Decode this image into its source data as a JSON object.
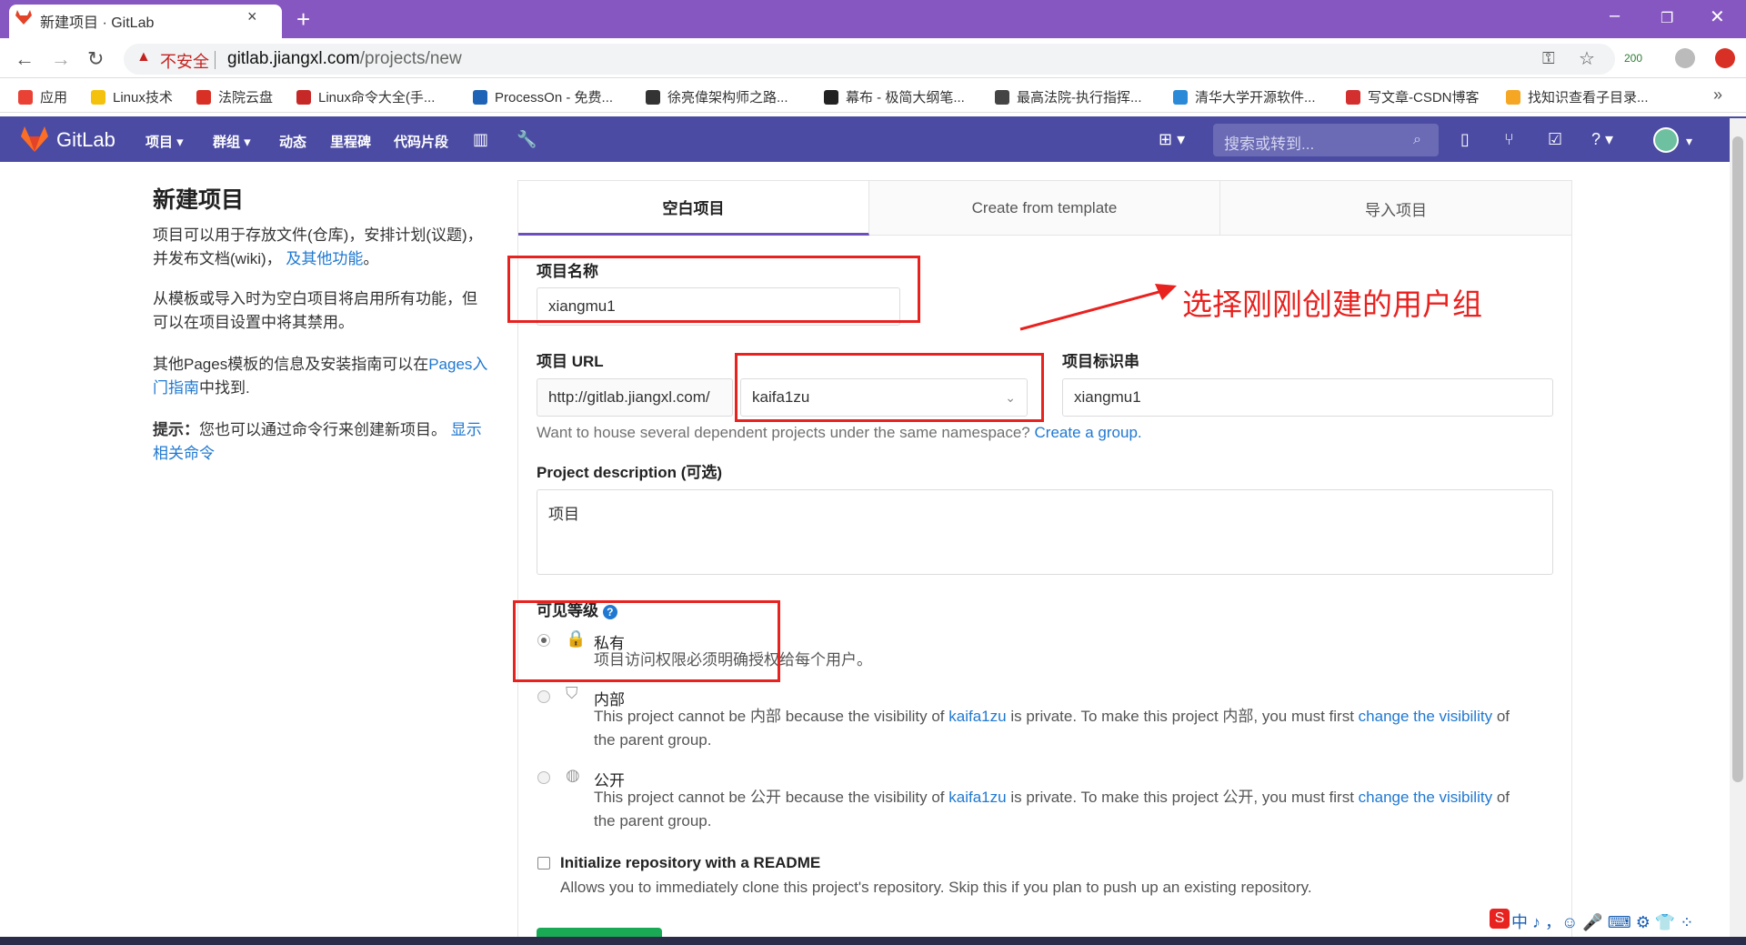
{
  "browser": {
    "tab_title": "新建项目 · GitLab",
    "close_glyph": "×",
    "newtab_glyph": "+",
    "insecure_label": "不安全",
    "url_host": "gitlab.jiangxl.com",
    "url_path": "/projects/new",
    "ext_badge": "200",
    "bookmarks": [
      {
        "label": "应用",
        "color": "#e94235"
      },
      {
        "label": "Linux技术",
        "color": "#f4c20d"
      },
      {
        "label": "法院云盘",
        "color": "#d93025"
      },
      {
        "label": "Linux命令大全(手...",
        "color": "#c62828"
      },
      {
        "label": "ProcessOn - 免费...",
        "color": "#1e63b5"
      },
      {
        "label": "徐亮偉架构师之路...",
        "color": "#333333"
      },
      {
        "label": "幕布 - 极简大纲笔...",
        "color": "#222222"
      },
      {
        "label": "最高法院-执行指挥...",
        "color": "#444444"
      },
      {
        "label": "清华大学开源软件...",
        "color": "#2a8ad8"
      },
      {
        "label": "写文章-CSDN博客",
        "color": "#d32f2f"
      },
      {
        "label": "找知识查看子目录...",
        "color": "#f5a623"
      }
    ],
    "more_glyph": "»"
  },
  "gitlab": {
    "brand": "GitLab",
    "menu": [
      "项目",
      "群组",
      "动态",
      "里程碑",
      "代码片段"
    ],
    "search_placeholder": "搜索或转到..."
  },
  "sidebar": {
    "title": "新建项目",
    "p1": "项目可以用于存放文件(仓库)，安排计划(议题)，并发布文档(wiki)，",
    "p1_link": "及其他功能",
    "p1_end": "。",
    "p2": "从模板或导入时为空白项目将启用所有功能，但可以在项目设置中将其禁用。",
    "p3_start": "其他Pages模板的信息及安装指南可以在",
    "p3_link": "Pages入门指南",
    "p3_end": "中找到.",
    "tip_label": "提示：",
    "tip_text": "您也可以通过命令行来创建新项目。",
    "tip_link": "显示相关命令"
  },
  "tabs": [
    "空白项目",
    "Create from template",
    "导入项目"
  ],
  "form": {
    "name_label": "项目名称",
    "name_value": "xiangmu1",
    "url_label": "项目 URL",
    "url_prefix": "http://gitlab.jiangxl.com/",
    "namespace": "kaifa1zu",
    "slug_label": "项目标识串",
    "slug_value": "xiangmu1",
    "group_hint": "Want to house several dependent projects under the same namespace?",
    "group_link": "Create a group.",
    "desc_label": "Project description",
    "desc_optional": "(可选)",
    "desc_value": "项目",
    "visibility_label": "可见等级",
    "private_title": "私有",
    "private_desc": "项目访问权限必须明确授权给每个用户。",
    "internal_title": "内部",
    "internal_desc_a": "This project cannot be 内部 because the visibility of",
    "internal_desc_link": "kaifa1zu",
    "internal_desc_b": "is private. To make this project 内部, you must first",
    "internal_desc_link2": "change the visibility",
    "internal_desc_c": "of",
    "internal_desc_d": "the parent group.",
    "public_title": "公开",
    "public_desc_a": "This project cannot be 公开 because the visibility of",
    "public_desc_link": "kaifa1zu",
    "public_desc_b": "is private. To make this project 公开, you must first",
    "public_desc_link2": "change the visibility",
    "public_desc_c": "of",
    "public_desc_d": "the parent group.",
    "readme_label": "Initialize repository with a README",
    "readme_desc": "Allows you to immediately clone this project's repository. Skip this if you plan to push up an existing repository."
  },
  "annotation": "选择刚刚创建的用户组",
  "ime": "中 ♪ ，☺ 🎤 ⌨ ⚙ 👕 ⁘",
  "colors": {
    "purple_nav": "#4b4ba3",
    "tabbar": "#8657c0",
    "annot_red": "#e8221f",
    "link": "#1f78d1"
  }
}
